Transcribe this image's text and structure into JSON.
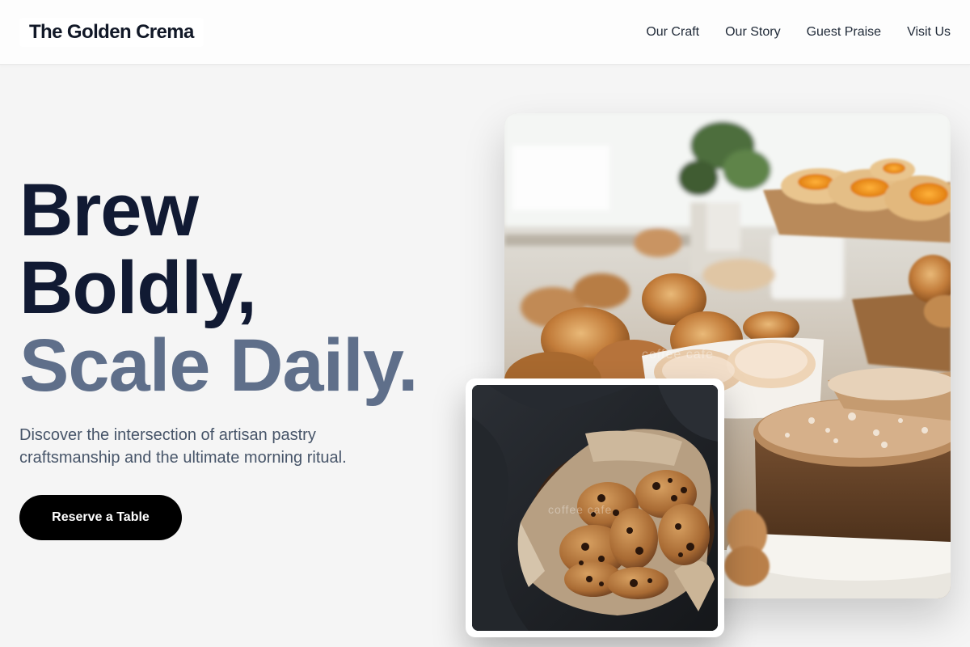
{
  "header": {
    "logo": "The Golden Crema",
    "nav": [
      "Our Craft",
      "Our Story",
      "Guest Praise",
      "Visit Us"
    ]
  },
  "hero": {
    "headline_line1": "Brew",
    "headline_line2": "Boldly,",
    "headline_line3": "Scale Daily.",
    "subtext": "Discover the intersection of artisan pastry craftsmanship and the ultimate morning ritual.",
    "cta_label": "Reserve a Table"
  },
  "images": {
    "main_alt": "Pastry display with scones, danishes and crumb cake",
    "secondary_alt": "Basket of chocolate chip cookies on dark cloth",
    "main_watermark": "coffee cafe",
    "secondary_watermark": "coffee cafe"
  },
  "colors": {
    "headline_dark": "#111a33",
    "headline_muted": "#5f6f8a",
    "cta_background": "#000000",
    "page_background": "#f5f5f5"
  }
}
